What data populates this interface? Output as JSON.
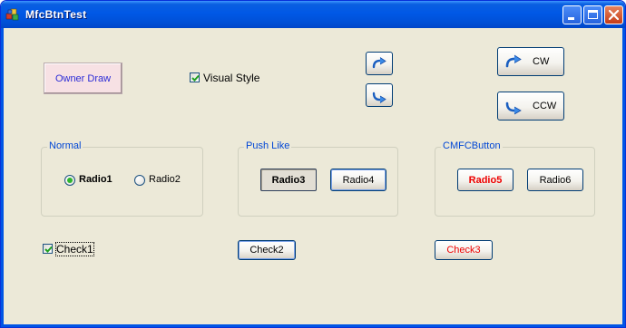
{
  "window": {
    "title": "MfcBtnTest",
    "controls": {
      "minimize": "minimize-icon",
      "maximize": "maximize-icon",
      "close": "close-icon"
    }
  },
  "buttons": {
    "owner_draw": "Owner Draw",
    "cw": "CW",
    "ccw": "CCW",
    "icon_cw": "rotate-cw-icon",
    "icon_ccw": "rotate-ccw-icon"
  },
  "visual_style": {
    "label": "Visual Style",
    "checked": true
  },
  "groups": {
    "normal": {
      "title": "Normal",
      "radio1": "Radio1",
      "radio2": "Radio2",
      "selected": "Radio1"
    },
    "push_like": {
      "title": "Push Like",
      "radio3": "Radio3",
      "radio4": "Radio4",
      "selected": "Radio3"
    },
    "mfc": {
      "title": "CMFCButton",
      "radio5": "Radio5",
      "radio6": "Radio6",
      "selected": "Radio5"
    }
  },
  "checks": {
    "check1": {
      "label": "Check1",
      "checked": true
    },
    "check2": "Check2",
    "check3": "Check3"
  },
  "colors": {
    "owner_draw_bg": "#f7e1e4",
    "owner_draw_text": "#2b2bd6",
    "group_title": "#0046d5",
    "mfc_text_red": "#ee0000",
    "titlebar_blue": "#0058e6"
  }
}
